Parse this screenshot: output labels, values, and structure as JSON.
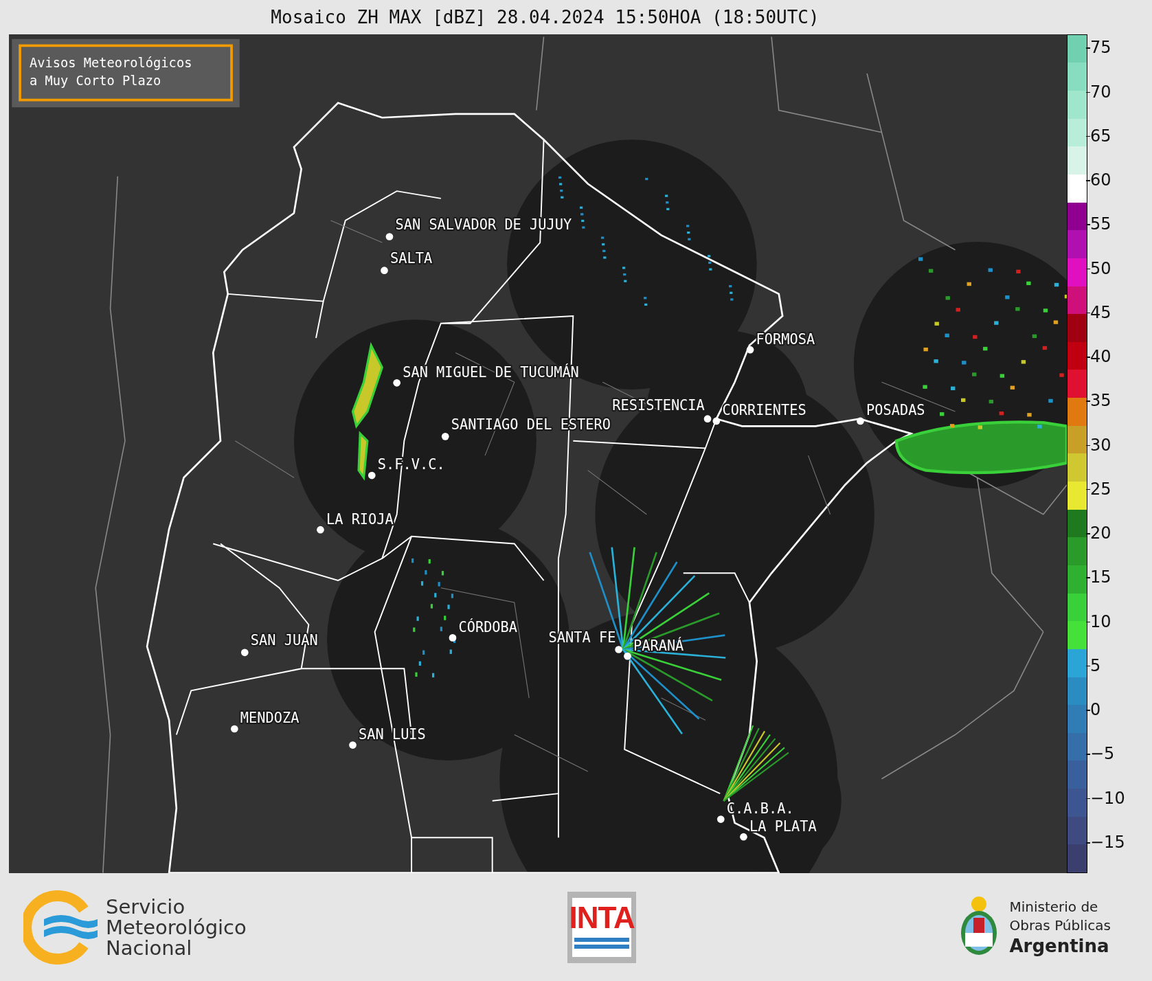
{
  "title": "Mosaico ZH MAX [dBZ] 28.04.2024 15:50HOA (18:50UTC)",
  "notice": [
    "Avisos Meteorológicos",
    "a Muy Corto Plazo"
  ],
  "cities": [
    "SAN SALVADOR DE JUJUY",
    "SALTA",
    "FORMOSA",
    "SAN MIGUEL DE TUCUMÁN",
    "RESISTENCIA",
    "CORRIENTES",
    "POSADAS",
    "SANTIAGO DEL ESTERO",
    "S.F.V.C.",
    "LA RIOJA",
    "CÓRDOBA",
    "SAN JUAN",
    "SANTA FE",
    "PARANÁ",
    "MENDOZA",
    "SAN LUIS",
    "C.A.B.A.",
    "LA PLATA"
  ],
  "scale": {
    "ticks": [
      "75",
      "70",
      "65",
      "60",
      "55",
      "50",
      "45",
      "40",
      "35",
      "30",
      "25",
      "20",
      "15",
      "10",
      "5",
      "0",
      "−5",
      "−10",
      "−15"
    ]
  },
  "footer": {
    "smn": [
      "Servicio",
      "Meteorológico",
      "Nacional"
    ],
    "inta": "INTA",
    "ministry": [
      "Ministerio de",
      "Obras Públicas",
      "Argentina"
    ]
  }
}
